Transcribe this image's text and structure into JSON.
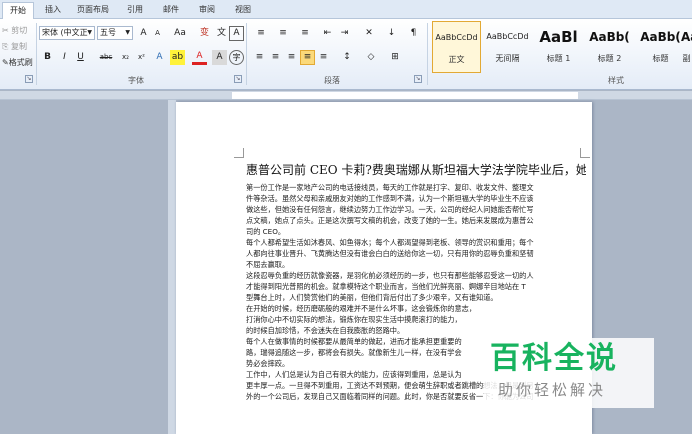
{
  "tabs": [
    "开始",
    "插入",
    "页面布局",
    "引用",
    "邮件",
    "审阅",
    "视图"
  ],
  "active_tab": "开始",
  "clipboard": {
    "cut": "剪切",
    "copy": "复制",
    "format_painter": "格式刷"
  },
  "font": {
    "name": "宋体 (中文正",
    "size": "五号",
    "grow": "A",
    "shrink": "A",
    "case": "Aa",
    "wen": "变",
    "border_A": "A",
    "bold": "B",
    "italic": "I",
    "underline": "U",
    "strike": "abc",
    "sub": "x₂",
    "sup": "x²",
    "effects": "A",
    "highlight": "ab",
    "color": "A",
    "shade": "A",
    "circle": "字",
    "group_label": "字体"
  },
  "paragraph": {
    "bullets": "≡",
    "numbering": "≡",
    "multilevel": "≡",
    "decrease_indent": "⇤",
    "increase_indent": "⇥",
    "asian_layout": "✕",
    "sort": "↓",
    "show_marks": "¶",
    "align_left": "≡",
    "center": "≡",
    "align_right": "≡",
    "justify": "≡",
    "distributed": "≡",
    "line_spacing": "↕",
    "shading": "◇",
    "borders": "⊞",
    "group_label": "段落"
  },
  "styles": {
    "items": [
      {
        "preview": "AaBbCcDd",
        "name": "正文"
      },
      {
        "preview": "AaBbCcDd",
        "name": "无间隔"
      },
      {
        "preview": "AaBl",
        "name": "标题 1"
      },
      {
        "preview": "AaBb(",
        "name": "标题 2"
      },
      {
        "preview": "AaBb(",
        "name": "标题"
      },
      {
        "preview": "Aa",
        "name": "副"
      }
    ],
    "group_label": "样式"
  },
  "document": {
    "title": "惠普公司前 CEO 卡莉?费奥瑞娜从斯坦福大学法学院毕业后，她的",
    "lines": [
      "第一份工作是一家地产公司的电话接线员，每天的工作就是打字、复印、收发文件、整理文",
      "件等杂活。虽然父母和亲戚朋友对她的工作感到不满，认为一个斯坦福大学的毕业生不应该",
      "做这些，但她没有任何怨言，继续边努力工作边学习。一天，公司的经纪人问她能否帮忙写",
      "点文稿，她点了点头。正是这次撰写文稿的机会，改变了她的一生。她后来发展成为惠普公",
      "司的 CEO。",
      "每个人都希望生活如沐春风、如鱼得水；每个人都渴望得到老板、领导的赏识和重用；每个",
      "人都向往事业晋升、飞黄腾达但没有谁会白白的送给你这一切，只有用你的忍辱负重和坚韧",
      "不屈去赢取。",
      "这段忍辱负重的经历就像瓷器，是羽化前必须经历的一步，也只有那些能够忍受这一切的人",
      "才能得到阳光普照的机会。就拿模特这个职业而言，当他们光鲜亮丽、婀娜辛目地站在 T",
      "型舞台上时，人们赞赏他们的美丽，但他们背后付出了多少艰辛，又有谁知道。",
      "在开始的时候，经历磨砺般的艰难并不是什么坏事，这会锻炼你的意志，",
      "打消你心中不切实际的想法，锻炼你在现实生活中摸爬滚打的能力，",
      "的时候自加珍惜，不会迷失在自我膨胀的怒路中。",
      "每个人在做事情的时候都要从最简单的做起，进而才能承担更重要的",
      "路，瑞得追随这一步，都将会有损失。就像新生儿一样，在没有学会",
      "势必会摔跤。",
      "工作中，人们总是认为自己有很大的能力，应该得到重用，总是认为",
      "更丰厚一点。一旦得不到重用，工资达不到预期，便会萌生辞职或者跳槽的想法，但是到另",
      "外的一个公司后，发现自己又面临着同样的问题。此时，你是否就要反省一下：你能为公司"
    ]
  },
  "watermark": {
    "title": "百科全说",
    "subtitle": "助你轻松解决"
  }
}
